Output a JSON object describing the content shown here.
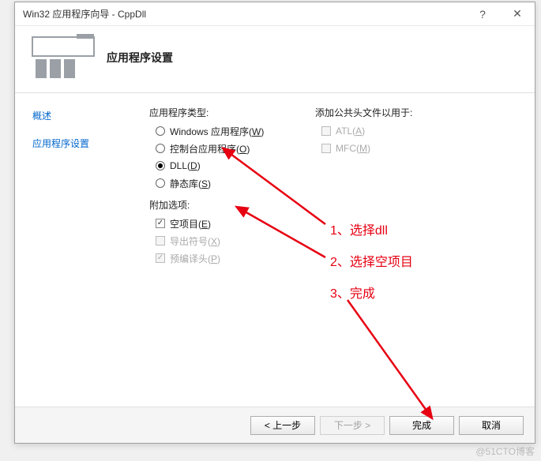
{
  "titlebar": {
    "title": "Win32 应用程序向导 - CppDll",
    "help": "?",
    "close": "✕"
  },
  "header": {
    "title": "应用程序设置"
  },
  "sidebar": {
    "overview": "概述",
    "settings": "应用程序设置"
  },
  "main": {
    "app_type_label": "应用程序类型:",
    "radio_windows": "Windows 应用程序",
    "radio_windows_accel": "W",
    "radio_console": "控制台应用程序",
    "radio_console_accel": "O",
    "radio_dll": "DLL",
    "radio_dll_accel": "D",
    "radio_static": "静态库",
    "radio_static_accel": "S",
    "extra_label": "附加选项:",
    "chk_empty": "空项目",
    "chk_empty_accel": "E",
    "chk_export": "导出符号",
    "chk_export_accel": "X",
    "chk_precomp": "预编译头",
    "chk_precomp_accel": "P",
    "public_headers_label": "添加公共头文件以用于:",
    "chk_atl": "ATL",
    "chk_atl_accel": "A",
    "chk_mfc": "MFC",
    "chk_mfc_accel": "M"
  },
  "footer": {
    "prev": "< 上一步",
    "next": "下一步 >",
    "finish": "完成",
    "cancel": "取消"
  },
  "annotations": {
    "step1": "1、选择dll",
    "step2": "2、选择空项目",
    "step3": "3、完成"
  },
  "watermark": "@51CTO博客"
}
